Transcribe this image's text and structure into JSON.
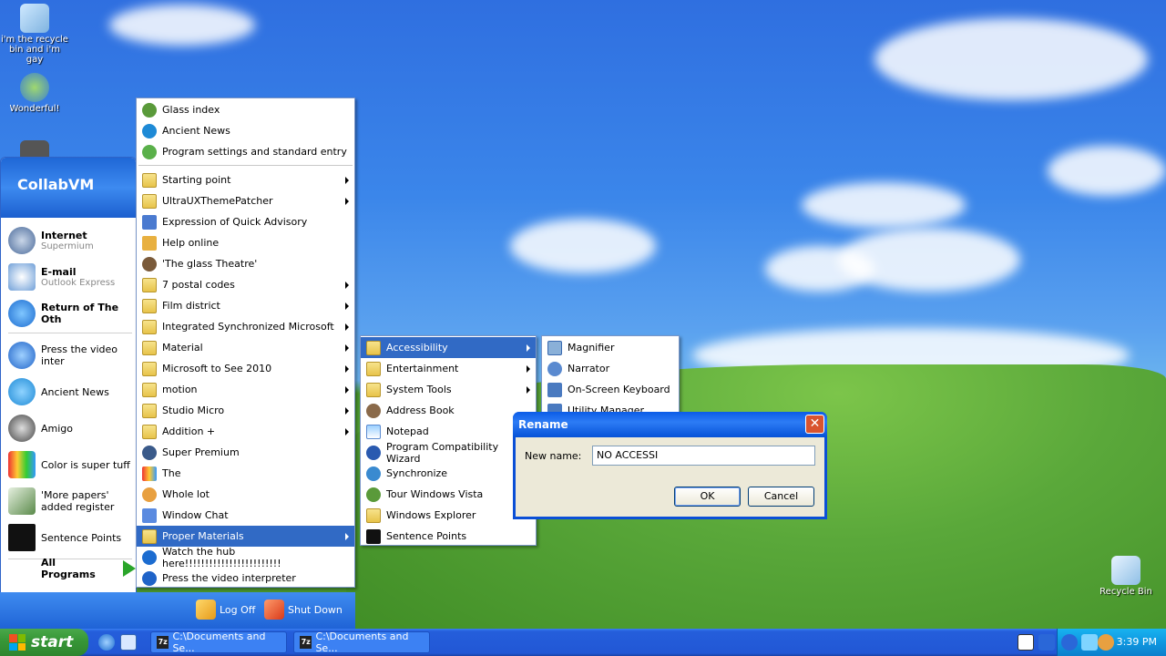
{
  "desktop": {
    "icons": [
      {
        "label": "i'm the recycle bin and i'm gay"
      },
      {
        "label": "Wonderful!"
      },
      {
        "label": "Recycle Bin"
      }
    ]
  },
  "start_menu": {
    "user": "CollabVM",
    "pinned": [
      {
        "title": "Internet",
        "subtitle": "Supermium"
      },
      {
        "title": "E-mail",
        "subtitle": "Outlook Express"
      },
      {
        "title": "Return of The Oth"
      }
    ],
    "recent": [
      "Press the video inter",
      "Ancient News",
      "Amigo",
      "Color is super tuff",
      "'More papers' added register",
      "Sentence Points"
    ],
    "all_programs": "All Programs",
    "log_off": "Log Off",
    "shut_down": "Shut Down"
  },
  "programs_menu": {
    "top": [
      "Glass index",
      "Ancient News",
      "Program settings and standard entry"
    ],
    "items": [
      "Starting point",
      "UltraUXThemePatcher",
      "Expression of Quick Advisory",
      "Help online",
      "'The glass Theatre'",
      "7 postal codes",
      "Film district",
      "Integrated Synchronized Microsoft",
      "Material",
      "Microsoft to See 2010",
      "motion",
      "Studio Micro",
      "Addition +",
      "Super Premium",
      "The",
      "Whole lot",
      "Window Chat",
      "Proper Materials",
      "Watch the hub here!!!!!!!!!!!!!!!!!!!!!!!!",
      "Press the video interpreter"
    ]
  },
  "materials_menu": {
    "items": [
      "Accessibility",
      "Entertainment",
      "System Tools",
      "Address Book",
      "Notepad",
      "Program Compatibility Wizard",
      "Synchronize",
      "Tour Windows Vista",
      "Windows Explorer",
      "Sentence Points"
    ]
  },
  "accessibility_menu": {
    "items": [
      "Magnifier",
      "Narrator",
      "On-Screen Keyboard",
      "Utility Manager"
    ]
  },
  "rename_dialog": {
    "title": "Rename",
    "label": "New name:",
    "value": "NO ACCESSI",
    "ok": "OK",
    "cancel": "Cancel"
  },
  "taskbar": {
    "start": "start",
    "tasks": [
      "C:\\Documents and Se...",
      "C:\\Documents and Se..."
    ],
    "clock": "3:39 PM"
  }
}
